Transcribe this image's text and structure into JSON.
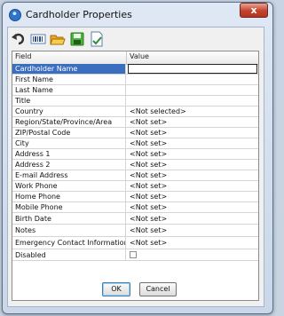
{
  "window": {
    "title": "Cardholder Properties",
    "close_label": "x"
  },
  "toolbar": {
    "icons": [
      "undo-icon",
      "barcode-icon",
      "open-folder-icon",
      "save-icon",
      "document-check-icon"
    ]
  },
  "grid": {
    "headers": {
      "field": "Field",
      "value": "Value"
    },
    "rows": [
      {
        "field": "Cardholder Name",
        "value": ""
      },
      {
        "field": "First Name",
        "value": ""
      },
      {
        "field": "Last Name",
        "value": ""
      },
      {
        "field": "Title",
        "value": ""
      },
      {
        "field": "Country",
        "value": "<Not selected>"
      },
      {
        "field": "Region/State/Province/Area",
        "value": "<Not set>"
      },
      {
        "field": "ZIP/Postal Code",
        "value": "<Not set>"
      },
      {
        "field": "City",
        "value": "<Not set>"
      },
      {
        "field": "Address 1",
        "value": "<Not set>"
      },
      {
        "field": "Address 2",
        "value": "<Not set>"
      },
      {
        "field": "E-mail Address",
        "value": "<Not set>"
      },
      {
        "field": "Work Phone",
        "value": "<Not set>"
      },
      {
        "field": "Home Phone",
        "value": "<Not set>"
      },
      {
        "field": "Mobile Phone",
        "value": "<Not set>"
      },
      {
        "field": "Birth Date",
        "value": "<Not set>"
      },
      {
        "field": "Notes",
        "value": "<Not set>"
      },
      {
        "field": "Emergency Contact Information",
        "value": "<Not set>"
      },
      {
        "field": "Disabled",
        "value": ""
      }
    ]
  },
  "buttons": {
    "ok": "OK",
    "cancel": "Cancel"
  },
  "colors": {
    "selection": "#3a6fbf",
    "close": "#c4422d"
  }
}
